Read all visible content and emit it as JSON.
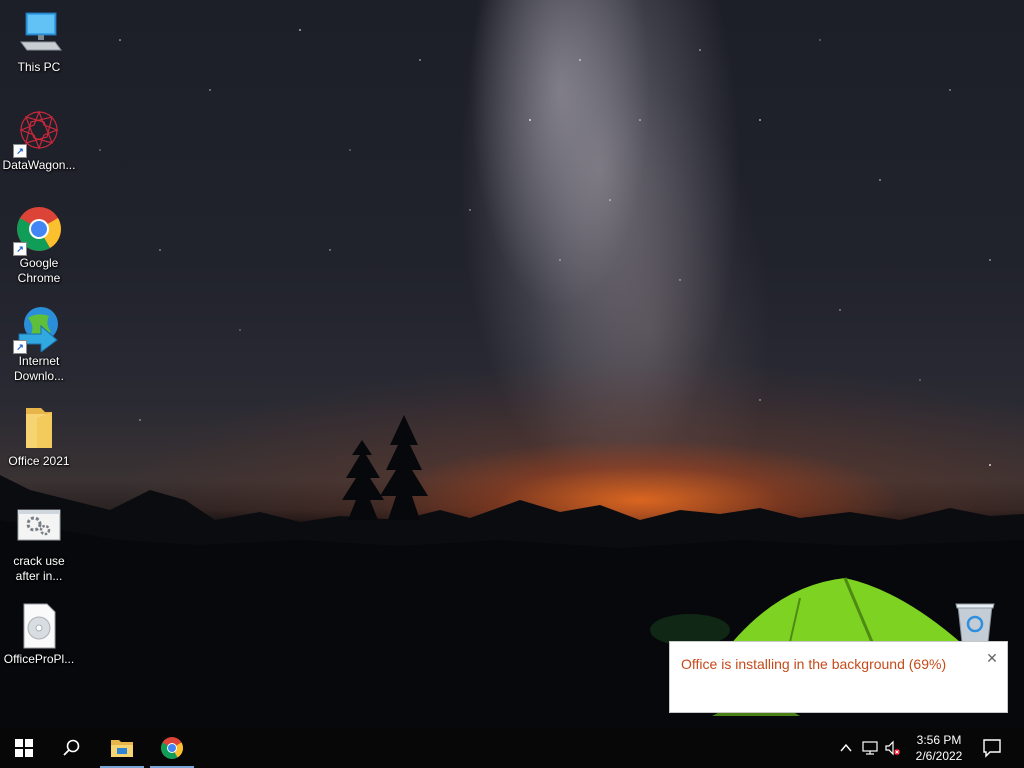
{
  "desktop": {
    "icons": [
      {
        "label": "This PC",
        "icon": "computer-icon"
      },
      {
        "label": "DataWagon...",
        "icon": "datawagon-icon",
        "shortcut": true
      },
      {
        "label": "Google Chrome",
        "icon": "chrome-icon",
        "shortcut": true
      },
      {
        "label": "Internet Downlo...",
        "icon": "idm-icon",
        "shortcut": true
      },
      {
        "label": "Office 2021",
        "icon": "folder-icon"
      },
      {
        "label": "crack use after in...",
        "icon": "settings-file-icon"
      },
      {
        "label": "OfficeProPl...",
        "icon": "disc-image-icon"
      }
    ],
    "recycle_bin": {
      "icon": "recycle-bin-icon"
    }
  },
  "notification": {
    "message": "Office is installing in the background (69%)",
    "progress": 0.69,
    "close_glyph": "✕"
  },
  "taskbar": {
    "start_icon": "windows-start-icon",
    "search_icon": "search-icon",
    "pinned": [
      {
        "name": "file-explorer-icon",
        "active": true
      },
      {
        "name": "chrome-icon",
        "active": true
      }
    ],
    "tray": {
      "icons": [
        "chevron-up-icon",
        "network-icon",
        "volume-muted-icon"
      ],
      "time": "3:56 PM",
      "date": "2/6/2022"
    },
    "action_center_icon": "notification-icon"
  },
  "colors": {
    "toast_text": "#c44b1a",
    "taskbar": "#070707",
    "active_indicator": "#7aa7d8"
  }
}
